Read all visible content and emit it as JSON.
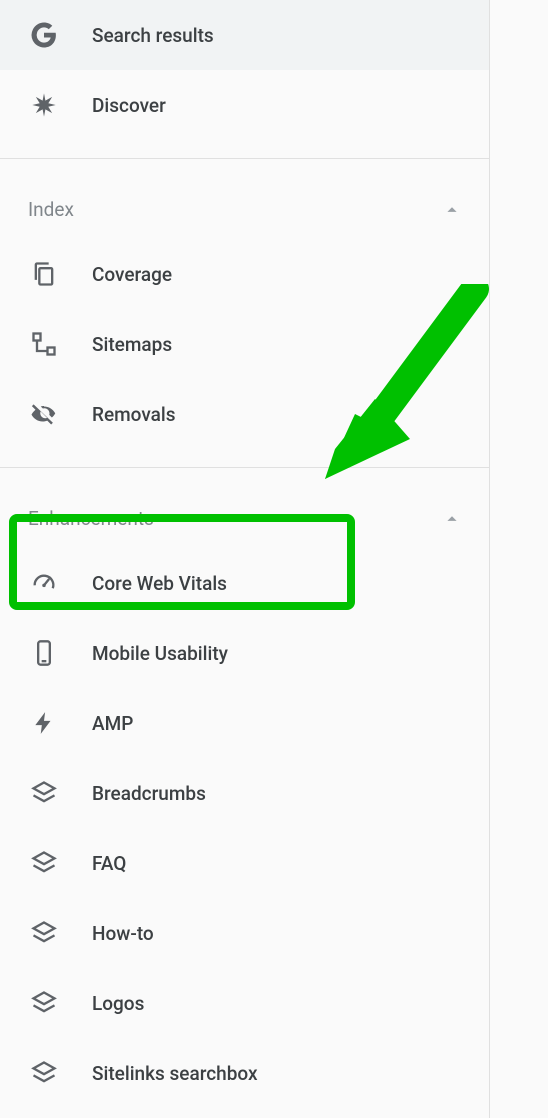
{
  "topItems": [
    {
      "label": "Search results",
      "icon": "google"
    },
    {
      "label": "Discover",
      "icon": "asterisk"
    }
  ],
  "sections": [
    {
      "title": "Index",
      "expanded": true,
      "items": [
        {
          "label": "Coverage",
          "icon": "copy-doc"
        },
        {
          "label": "Sitemaps",
          "icon": "tree"
        },
        {
          "label": "Removals",
          "icon": "visibility-off"
        }
      ]
    },
    {
      "title": "Enhancements",
      "expanded": true,
      "items": [
        {
          "label": "Core Web Vitals",
          "icon": "speed"
        },
        {
          "label": "Mobile Usability",
          "icon": "smartphone"
        },
        {
          "label": "AMP",
          "icon": "bolt"
        },
        {
          "label": "Breadcrumbs",
          "icon": "layers"
        },
        {
          "label": "FAQ",
          "icon": "layers"
        },
        {
          "label": "How-to",
          "icon": "layers"
        },
        {
          "label": "Logos",
          "icon": "layers"
        },
        {
          "label": "Sitelinks searchbox",
          "icon": "layers"
        }
      ]
    }
  ],
  "highlight": {
    "section": 1,
    "item": 0
  },
  "arrow_color": "#00c000"
}
